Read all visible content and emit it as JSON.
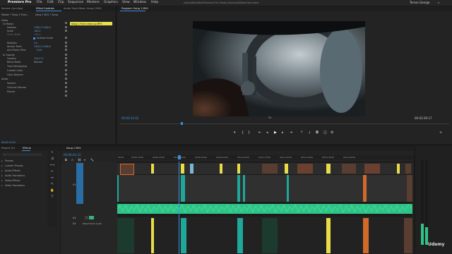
{
  "menubar": {
    "app": "Premiere Pro",
    "items": [
      "File",
      "Edit",
      "Clip",
      "Sequence",
      "Markers",
      "Graphics",
      "View",
      "Window",
      "Help"
    ],
    "path": "/Users/Mac/Work/Premiere Pro Studio Sessions/Edited Document",
    "user": "Tomas George"
  },
  "source_panel": {
    "tabs": [
      "Source: (no clips)",
      "Effect Controls",
      "Audio Track Mixer: Song 1 MX1"
    ],
    "clip_label": "Master * Song 1 Flute...",
    "seq_label": "Song 1 MX1 * Song",
    "clip_chip": "Song 1 Flute close up.MP4",
    "rows": [
      {
        "label": "Video",
        "value": ""
      },
      {
        "label": "fx Motion",
        "value": ""
      },
      {
        "label": "Position",
        "value": "1280.0   1080.0"
      },
      {
        "label": "Scale",
        "value": "100.0"
      },
      {
        "label": "Scale Width",
        "value": "100.0"
      },
      {
        "label": "",
        "value": "Uniform Scale"
      },
      {
        "label": "Rotation",
        "value": "0.0"
      },
      {
        "label": "Anchor Point",
        "value": "1920.0   1080.0"
      },
      {
        "label": "Anti-flicker Filter",
        "value": "0.00"
      },
      {
        "label": "fx Opacity",
        "value": ""
      },
      {
        "label": "Opacity",
        "value": "100.0 %"
      },
      {
        "label": "Blend Mode",
        "value": "Normal"
      },
      {
        "label": "Time Remapping",
        "value": ""
      },
      {
        "label": "Lumetri Color",
        "value": ""
      },
      {
        "label": "Color Balance",
        "value": ""
      },
      {
        "label": "Audio",
        "value": ""
      },
      {
        "label": "Volume",
        "value": ""
      },
      {
        "label": "Channel Volume",
        "value": ""
      },
      {
        "label": "Panner",
        "value": ""
      }
    ],
    "timecode": "00:00:43:02"
  },
  "program": {
    "tab": "Program: Song 1 MX1",
    "timecode_left": "00:00:43:02",
    "fit": "Fit",
    "timecode_right": "00:03:39:17"
  },
  "project": {
    "tabs": [
      "Project: Ed",
      "Effects"
    ],
    "bins": [
      "Presets",
      "Lumetri Presets",
      "Audio Effects",
      "Audio Transitions",
      "Video Effects",
      "Video Transitions"
    ]
  },
  "timeline": {
    "tab": "Song 1 MX1",
    "timecode": "00:00:42:23",
    "ruler": [
      "00:00",
      "00:00:10:00",
      "00:00:20:00",
      "00:00:30:00",
      "00:00:40:00",
      "00:00:50:00",
      "00:01:00:00",
      "00:01:10:00",
      "00:01:20:00",
      "00:01:30:00",
      "00:01:40:00",
      "00:01:50:00"
    ],
    "tracks": [
      "V3",
      "V2",
      "V1",
      "A1",
      "A2"
    ],
    "a2_name": "Mixed Track Audio"
  },
  "watermark": "Udemy",
  "colors": {
    "video_clip": "#1fa79a",
    "audio_clip": "#2fc487",
    "audio_wave": "#55e3a7",
    "marker_yellow": "#e8dc48",
    "orange_clip": "#cf6a2b",
    "blue_track": "#2a6ca4",
    "timecode_blue": "#3a8ee0"
  }
}
